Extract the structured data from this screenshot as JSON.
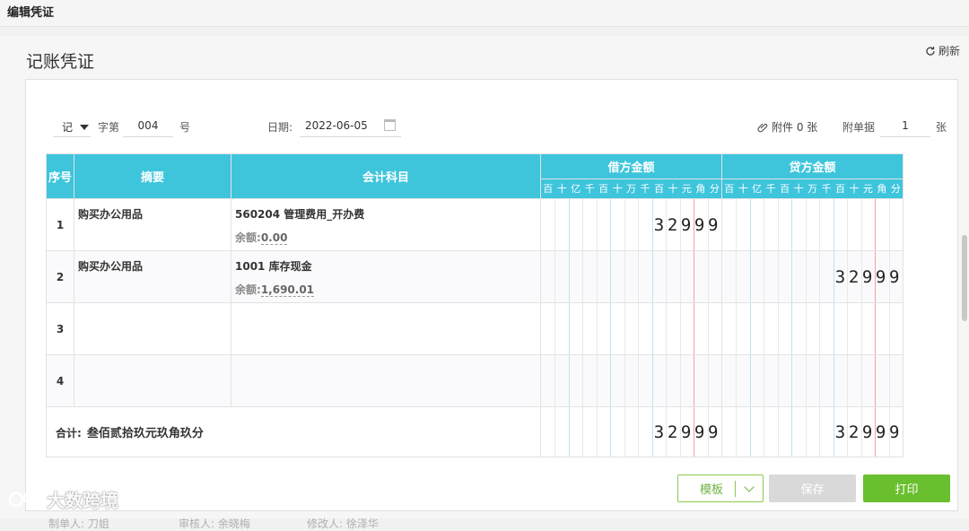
{
  "header": {
    "title": "编辑凭证"
  },
  "panel": {
    "title": "记账凭证",
    "refresh_label": "刷新"
  },
  "form": {
    "voucher_type": "记",
    "zi_label": "字第",
    "voucher_no": "004",
    "hao_label": "号",
    "date_label": "日期:",
    "date": "2022-06-05",
    "attachment": "附件 0 张",
    "fdj_label": "附单据",
    "fdj_count": "1",
    "zhang_label": "张"
  },
  "table": {
    "headers": {
      "seq": "序号",
      "summary": "摘要",
      "account": "会计科目",
      "debit": "借方金额",
      "credit": "贷方金额"
    },
    "digit_units": [
      "百",
      "十",
      "亿",
      "千",
      "百",
      "十",
      "万",
      "千",
      "百",
      "十",
      "元",
      "角",
      "分"
    ],
    "balance_label": "余额:",
    "rows": [
      {
        "seq": "1",
        "summary": "购买办公用品",
        "account": "560204 管理费用_开办费",
        "balance": "0.00",
        "debit": "32999",
        "credit": ""
      },
      {
        "seq": "2",
        "summary": "购买办公用品",
        "account": "1001 库存现金",
        "balance": "1,690.01",
        "debit": "",
        "credit": "32999"
      },
      {
        "seq": "3",
        "summary": "",
        "account": "",
        "balance": "",
        "debit": "",
        "credit": ""
      },
      {
        "seq": "4",
        "summary": "",
        "account": "",
        "balance": "",
        "debit": "",
        "credit": ""
      }
    ],
    "total": {
      "label": "合计:",
      "amount_words": "叁佰贰拾玖元玖角玖分",
      "debit": "32999",
      "credit": "32999"
    }
  },
  "footer": {
    "maker": "制单人: 刀姐",
    "reviewer": "审核人: 余晓梅",
    "modifier": "修改人: 徐泽华"
  },
  "buttons": {
    "template": "模板",
    "save": "保存",
    "print": "打印"
  },
  "watermark": "大数跨境",
  "colors": {
    "header_bg": "#3ec5dc",
    "accent_green": "#6abf2e",
    "disabled": "#d9d9d9"
  }
}
